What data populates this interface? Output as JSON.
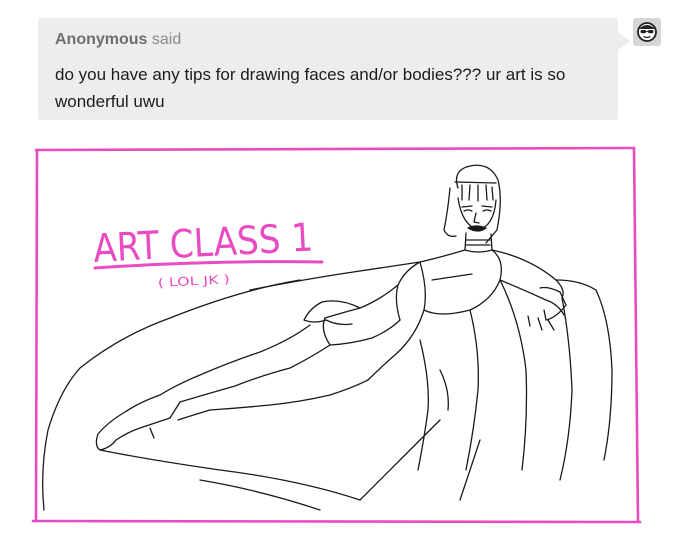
{
  "ask": {
    "asker_name": "Anonymous",
    "said_label": "said",
    "question": "do you have any tips for drawing faces and/or bodies??? ur art is so wonderful uwu"
  },
  "answerer": {
    "avatar_icon": "sunglasses-face-icon"
  },
  "artwork": {
    "title": "ART CLASS 1",
    "subtitle": "( LOL JK )",
    "frame_color": "#e94bc2",
    "ink_color": "#1a1a1a"
  }
}
